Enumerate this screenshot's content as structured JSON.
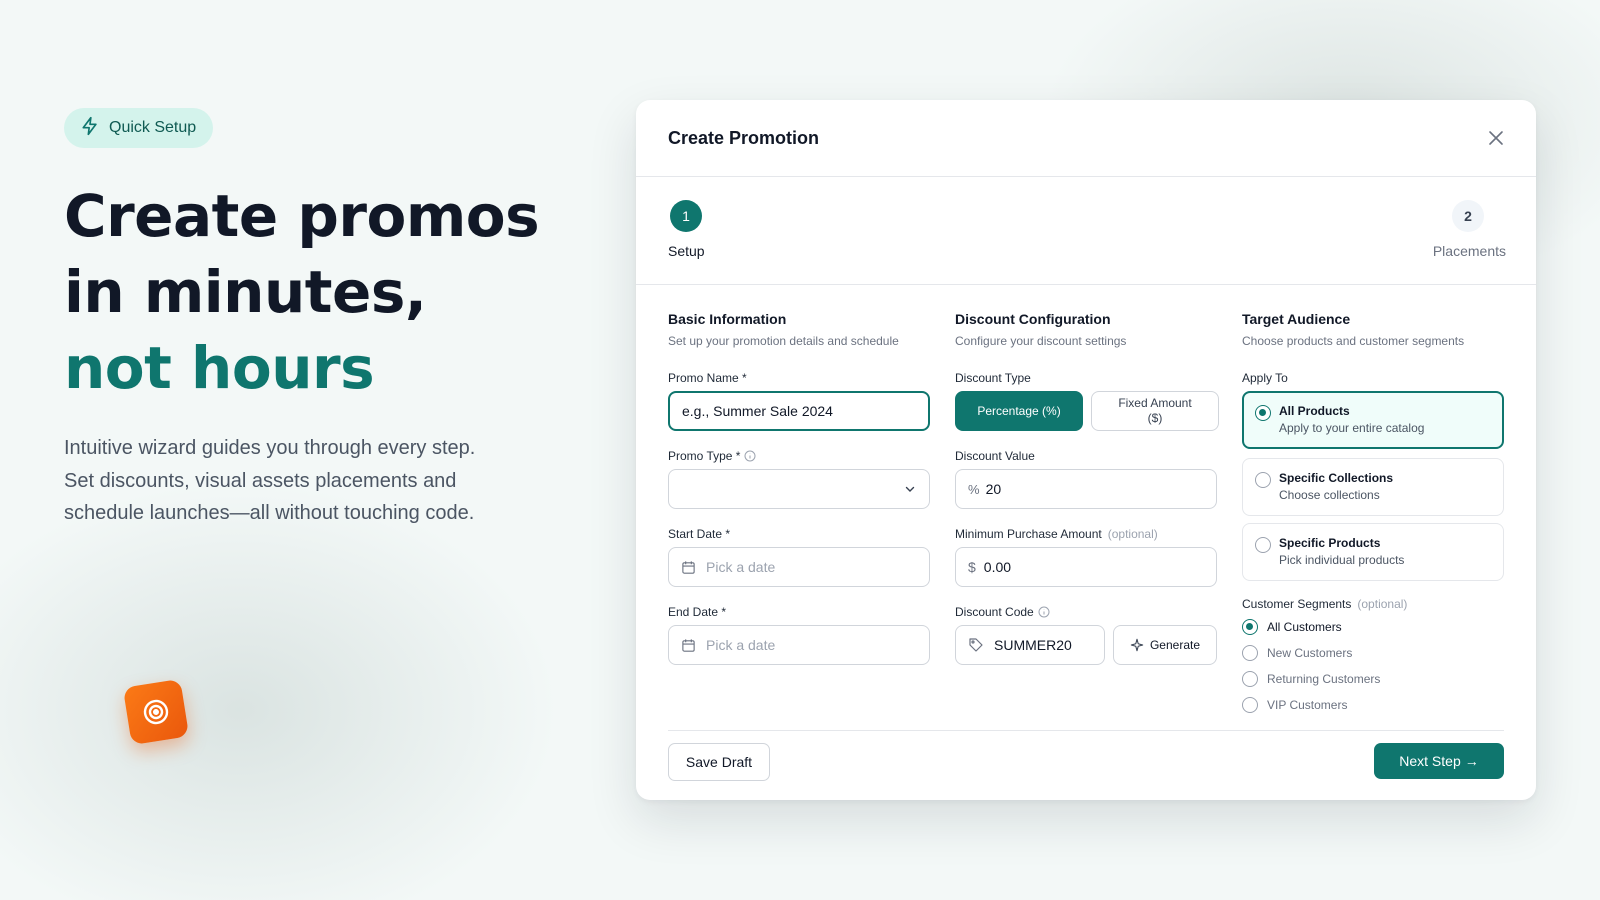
{
  "hero": {
    "badge": "Quick Setup",
    "badge_icon": "lightning-icon",
    "title_line1": "Create promos",
    "title_line2": "in minutes,",
    "title_line3": "not hours",
    "subtitle": "Intuitive wizard guides you through every step. Set discounts, visual assets placements and schedule launches—all without touching code."
  },
  "modal": {
    "title": "Create Promotion",
    "steps": [
      {
        "number": "1",
        "label": "Setup",
        "active": true
      },
      {
        "number": "2",
        "label": "Placements",
        "active": false
      }
    ],
    "basic": {
      "title": "Basic Information",
      "description": "Set up your promotion details and schedule",
      "promo_name_label": "Promo Name *",
      "promo_name_value": "e.g., Summer Sale 2024",
      "promo_type_label": "Promo Type *",
      "promo_type_value": "",
      "start_date_label": "Start Date *",
      "start_date_placeholder": "Pick a date",
      "end_date_label": "End Date *",
      "end_date_placeholder": "Pick a date"
    },
    "discount": {
      "title": "Discount Configuration",
      "description": "Configure your discount settings",
      "type_label": "Discount Type",
      "type_options": [
        "Percentage (%)",
        "Fixed Amount ($)"
      ],
      "type_selected": "Percentage (%)",
      "value_label": "Discount Value",
      "value_prefix": "%",
      "value": "20",
      "min_purchase_label": "Minimum Purchase Amount",
      "optional": "(optional)",
      "min_purchase_prefix": "$",
      "min_purchase_value": "0.00",
      "code_label": "Discount Code",
      "code_value": "SUMMER20",
      "generate_label": "Generate"
    },
    "audience": {
      "title": "Target Audience",
      "description": "Choose products and customer segments",
      "apply_to_label": "Apply To",
      "apply_options": [
        {
          "title": "All Products",
          "desc": "Apply to your entire catalog",
          "selected": true
        },
        {
          "title": "Specific Collections",
          "desc": "Choose collections",
          "selected": false
        },
        {
          "title": "Specific Products",
          "desc": "Pick individual products",
          "selected": false
        }
      ],
      "segments_label": "Customer Segments",
      "segments_optional": "(optional)",
      "segments": [
        {
          "label": "All Customers",
          "selected": true
        },
        {
          "label": "New Customers",
          "selected": false
        },
        {
          "label": "Returning Customers",
          "selected": false
        },
        {
          "label": "VIP Customers",
          "selected": false
        }
      ]
    },
    "footer": {
      "save_draft": "Save Draft",
      "next_step": "Next Step",
      "next_arrow": "→"
    }
  },
  "colors": {
    "accent": "#0f766e",
    "accent_light": "#d4f3ec",
    "orange": "#ea580c"
  }
}
